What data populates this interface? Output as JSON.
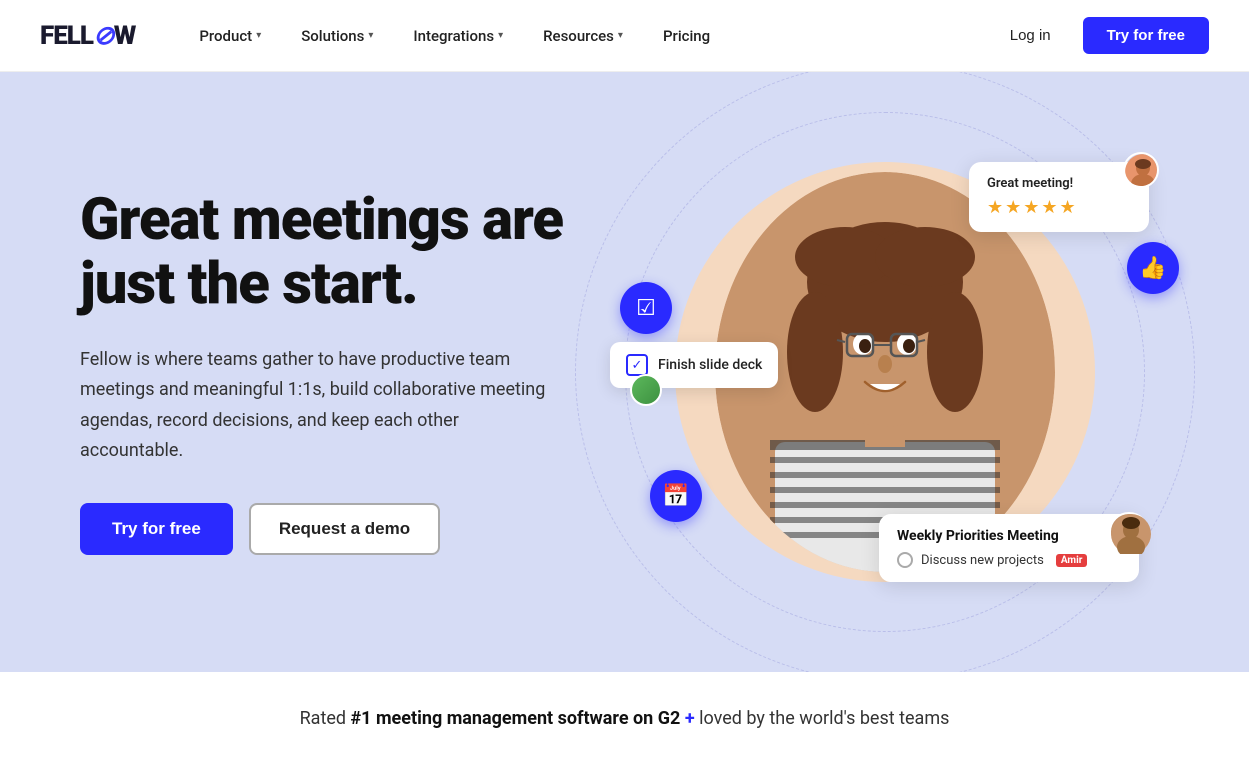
{
  "brand": {
    "name_part1": "FELL",
    "name_slash": "⊘",
    "name_part2": "W"
  },
  "navbar": {
    "logo_text": "FELLOW",
    "items": [
      {
        "label": "Product",
        "has_dropdown": true
      },
      {
        "label": "Solutions",
        "has_dropdown": true
      },
      {
        "label": "Integrations",
        "has_dropdown": true
      },
      {
        "label": "Resources",
        "has_dropdown": true
      },
      {
        "label": "Pricing",
        "has_dropdown": false
      }
    ],
    "login_label": "Log in",
    "try_label": "Try for free"
  },
  "hero": {
    "title": "Great meetings are just the start.",
    "description": "Fellow is where teams gather to have productive team meetings and meaningful 1:1s, build collaborative meeting agendas, record decisions, and keep each other accountable.",
    "cta_primary": "Try for free",
    "cta_secondary": "Request a demo"
  },
  "ui_cards": {
    "meeting_rating": {
      "title": "Great meeting!",
      "stars": "★★★★★"
    },
    "task": {
      "label": "Finish slide deck"
    },
    "weekly": {
      "title": "Weekly Priorities Meeting",
      "item": "Discuss new projects",
      "badge": "Amir"
    }
  },
  "bottom": {
    "text_before": "Rated ",
    "highlight": "#1 meeting management software on G2",
    "plus": " + ",
    "text_after": "loved by the world's best teams"
  }
}
